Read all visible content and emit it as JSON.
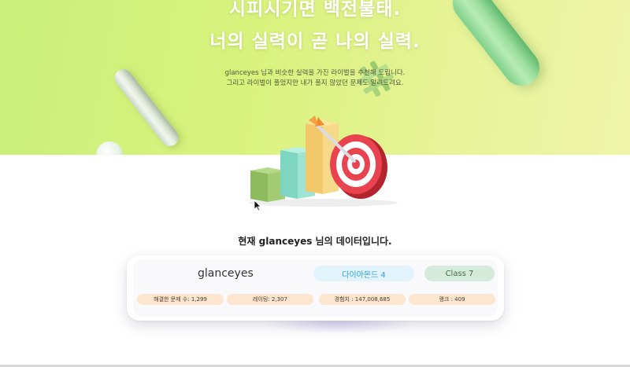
{
  "hero": {
    "title_line1": "시피시기면 백전불태.",
    "title_line2": "너의 실력이 곧 나의 실력.",
    "subtitle_line1": "glanceyes 님과 비슷한 실력을 가진 라이벌을 추천해 드립니다.",
    "subtitle_line2": "그리고 라이벌이 풀었지만 내가 풀지 않았던 문제도 알려드려요."
  },
  "section": {
    "heading": "현재 glanceyes 님의 데이터입니다."
  },
  "profile": {
    "username": "glanceyes",
    "tier": "다이아몬드 4",
    "class": "Class 7",
    "stats": {
      "solved": "해결한 문제 수: 1,299",
      "rating": "레이팅: 2,307",
      "exp": "경험치 : 147,008,685",
      "rank": "랭크 : 409"
    }
  },
  "colors": {
    "hero_gradient_start": "#c8f07a",
    "hero_gradient_end": "#eef5a8",
    "tier_text": "#2aa3e0",
    "tier_bg": "#e3f3fc",
    "class_bg": "#d5eadb",
    "stat_bg": "#fde6cf"
  },
  "icons": {
    "cursor": "mouse-pointer-icon",
    "illustration": "target-bar-chart-illustration",
    "hash": "hash-3d-icon"
  }
}
